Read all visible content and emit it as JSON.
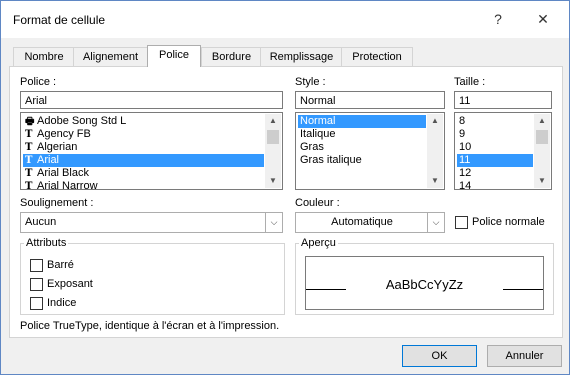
{
  "window": {
    "title": "Format de cellule",
    "help": "?",
    "close": "✕"
  },
  "tabs": [
    "Nombre",
    "Alignement",
    "Police",
    "Bordure",
    "Remplissage",
    "Protection"
  ],
  "police": {
    "label": "Police :",
    "value": "Arial",
    "items": [
      "Adobe Song Std L",
      "Agency FB",
      "Algerian",
      "Arial",
      "Arial Black",
      "Arial Narrow"
    ],
    "selected": "Arial"
  },
  "style": {
    "label": "Style :",
    "value": "Normal",
    "items": [
      "Normal",
      "Italique",
      "Gras",
      "Gras italique"
    ],
    "selected": "Normal"
  },
  "taille": {
    "label": "Taille :",
    "value": "11",
    "items": [
      "8",
      "9",
      "10",
      "11",
      "12",
      "14"
    ],
    "selected": "11"
  },
  "soulignement": {
    "label": "Soulignement :",
    "value": "Aucun"
  },
  "couleur": {
    "label": "Couleur :",
    "value": "Automatique"
  },
  "police_normale": {
    "label": "Police normale",
    "checked": false
  },
  "attributs": {
    "title": "Attributs",
    "items": [
      {
        "label": "Barré",
        "checked": false
      },
      {
        "label": "Exposant",
        "checked": false
      },
      {
        "label": "Indice",
        "checked": false
      }
    ]
  },
  "apercu": {
    "title": "Aperçu",
    "sample": "AaBbCcYyZz"
  },
  "info": "Police TrueType, identique à l'écran et à l'impression.",
  "buttons": {
    "ok": "OK",
    "cancel": "Annuler"
  }
}
